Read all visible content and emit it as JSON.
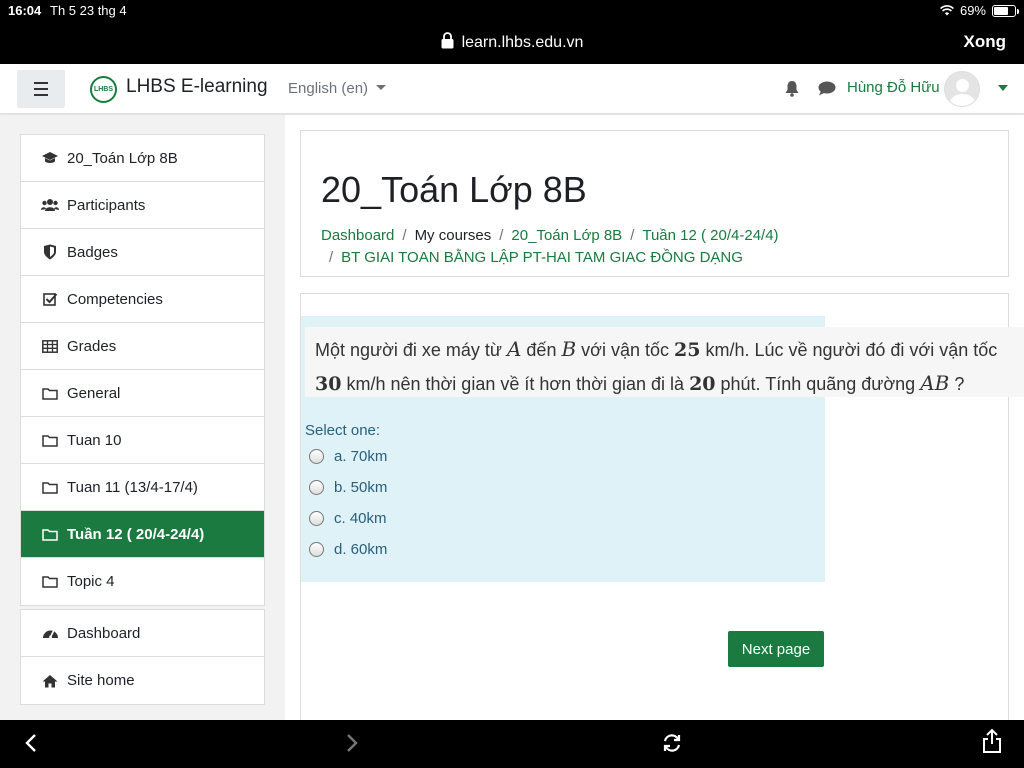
{
  "status_bar": {
    "time": "16:04",
    "date": "Th 5 23 thg 4",
    "battery": "69%",
    "battery_level": 0.69
  },
  "browser": {
    "url": "learn.lhbs.edu.vn",
    "done_label": "Xong"
  },
  "navbar": {
    "logo_text": "LHBS",
    "site_name": "LHBS E-learning",
    "language": "English (en)",
    "user_name": "Hùng Đỗ Hữu"
  },
  "drawer": {
    "course_items": [
      {
        "label": "20_Toán Lớp 8B",
        "icon": "graduation-cap-icon"
      },
      {
        "label": "Participants",
        "icon": "users-icon"
      },
      {
        "label": "Badges",
        "icon": "shield-icon"
      },
      {
        "label": "Competencies",
        "icon": "checkbox-icon"
      },
      {
        "label": "Grades",
        "icon": "table-icon"
      },
      {
        "label": "General",
        "icon": "folder-icon"
      },
      {
        "label": "Tuan 10",
        "icon": "folder-icon"
      },
      {
        "label": "Tuan 11 (13/4-17/4)",
        "icon": "folder-icon"
      },
      {
        "label": "Tuần 12 ( 20/4-24/4)",
        "icon": "folder-icon",
        "active": true
      },
      {
        "label": "Topic 4",
        "icon": "folder-icon"
      }
    ],
    "site_items": [
      {
        "label": "Dashboard",
        "icon": "dashboard-icon"
      },
      {
        "label": "Site home",
        "icon": "home-icon"
      }
    ]
  },
  "header": {
    "title": "20_Toán Lớp 8B",
    "breadcrumb": {
      "dashboard": "Dashboard",
      "my_courses": "My courses",
      "course": "20_Toán Lớp 8B",
      "week": "Tuần 12 ( 20/4-24/4)",
      "activity": "BT GIAI TOAN BẰNG LẬP PT-HAI TAM GIAC ĐỒNG DẠNG"
    }
  },
  "question": {
    "line1": {
      "t1": "Một người đi xe máy từ ",
      "v1": "A",
      "t2": " đến ",
      "v2": "B",
      "t3": " với vận tốc ",
      "n1": "25",
      "t4": " km/h. Lúc về người đó đi với vận tốc"
    },
    "line2": {
      "n2": "30",
      "t5": " km/h nên thời gian về ít hơn thời gian đi là ",
      "n3": "20",
      "t6": " phút. Tính quãng đường ",
      "v3": "AB",
      "t7": " ?"
    },
    "prompt": "Select one:",
    "options": [
      "a. 70km",
      "b. 50km",
      "c. 40km",
      "d. 60km"
    ],
    "next_label": "Next page"
  },
  "colors": {
    "accent": "#1a7a3f",
    "question_bg": "#def2f8",
    "option_text": "#2b5f78"
  }
}
